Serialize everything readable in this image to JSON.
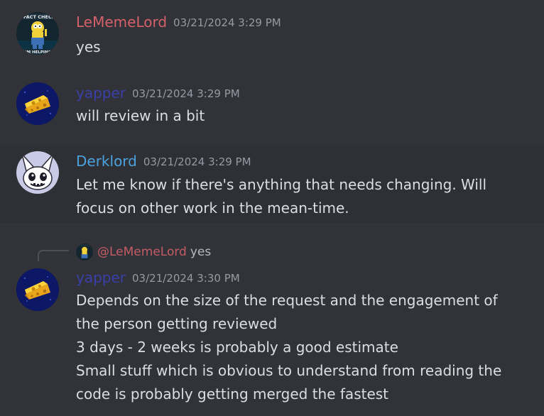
{
  "colors": {
    "background": "#313338",
    "highlight": "#2e3035",
    "text": "#dbdee1",
    "timestamp": "#949ba4",
    "lememelord": "#d4606a",
    "yapper": "#3b3fa8",
    "derklord": "#4aa3df"
  },
  "messages": [
    {
      "author": "LeMemeLord",
      "timestamp": "03/21/2024 3:29 PM",
      "avatar_icon": "homer-simpson-avatar-icon",
      "avatar_text_top": "I FACT CHECK",
      "avatar_text_bottom": "I'M HELPING",
      "lines": [
        "yes"
      ]
    },
    {
      "author": "yapper",
      "timestamp": "03/21/2024 3:29 PM",
      "avatar_icon": "cheese-avatar-icon",
      "lines": [
        "will review in a bit"
      ]
    },
    {
      "author": "Derklord",
      "timestamp": "03/21/2024 3:29 PM",
      "avatar_icon": "bunny-mask-avatar-icon",
      "lines": [
        "Let me know if there's anything that needs changing. Will",
        "focus on other work in the mean-time."
      ]
    },
    {
      "author": "yapper",
      "timestamp": "03/21/2024 3:30 PM",
      "avatar_icon": "cheese-avatar-icon",
      "reply": {
        "mention": "@LeMemeLord",
        "text": "yes"
      },
      "lines": [
        "Depends on the size of the request and the engagement of",
        "the person getting reviewed",
        "3 days - 2 weeks is probably a good estimate",
        "Small stuff which is obvious to understand from reading the",
        "code is probably getting merged the fastest"
      ]
    }
  ]
}
